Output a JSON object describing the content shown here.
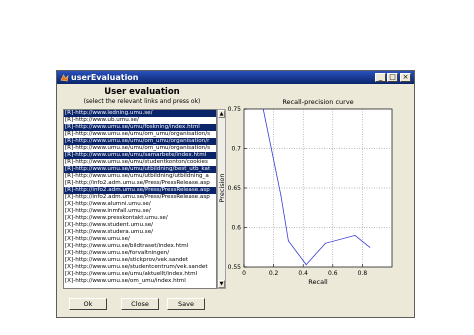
{
  "window": {
    "title": "userEvaluation",
    "buttons": {
      "minimize": "_",
      "maximize": "□",
      "close": "×"
    }
  },
  "panel": {
    "title": "User evaluation",
    "instructions": "(select the relevant links and press ok)"
  },
  "list": {
    "items": [
      {
        "label": "[R]-http://www.ledning.umu.se/",
        "selected": true
      },
      {
        "label": "[R]-http://www.ub.umu.se/",
        "selected": false
      },
      {
        "label": "[R]-http://www.umu.se/umu/foskning/index.html",
        "selected": true
      },
      {
        "label": "[R]-http://www.umu.se/umu/om_umu/organisation/s",
        "selected": false
      },
      {
        "label": "[R]-http://www.umu.se/umu/om_umu/organisation/r",
        "selected": true
      },
      {
        "label": "[R]-http://www.umu.se/umu/om_umu/organisation/s",
        "selected": false
      },
      {
        "label": "[R]-http://www.umu.se/umu/samarbete/index.html",
        "selected": true
      },
      {
        "label": "[R]-http://www.umu.se/umu/studentkonton/cookies",
        "selected": false
      },
      {
        "label": "[R]-http://www.umu.se/umu/utbildning/best_utb_kat",
        "selected": true
      },
      {
        "label": "[R]-http://www.umu.se/umu/utbildning/utbildning_a",
        "selected": false
      },
      {
        "label": "[R]-http://info2.adm.umu.se/Press/PressRelease.asp",
        "selected": false
      },
      {
        "label": "[R]-http://info2.adm.umu.se/Press/PressRelease.asp",
        "selected": true
      },
      {
        "label": "[X]-http://info2.adm.umu.se/Press/PressRelease.asp",
        "selected": false
      },
      {
        "label": "[X]-http://www.alumni.umu.se/",
        "selected": false
      },
      {
        "label": "[X]-http://www.inmfall.umu.se/",
        "selected": false
      },
      {
        "label": "[X]-http://www.presskontakt.umu.se/",
        "selected": false
      },
      {
        "label": "[X]-http://www.student.umu.se/",
        "selected": false
      },
      {
        "label": "[X]-http://www.studera.umu.se/",
        "selected": false
      },
      {
        "label": "[X]-http://www.umu.se/",
        "selected": false
      },
      {
        "label": "[X]-http://www.umu.se/bildtraset/index.html",
        "selected": false
      },
      {
        "label": "[X]-http://www.umu.se/forvaltningen/",
        "selected": false
      },
      {
        "label": "[X]-http://www.umu.se/stickprov/vek.sandet",
        "selected": false
      },
      {
        "label": "[X]-http://www.umu.se/studentcentrum/vek.sandet",
        "selected": false
      },
      {
        "label": "[X]-http://www.umu.se/umu/aktuellt/index.html",
        "selected": false
      },
      {
        "label": "[X]-http://www.umu.se/om_umu/index.html",
        "selected": false
      }
    ]
  },
  "buttons": {
    "ok": "Ok",
    "close": "Close",
    "save": "Save"
  },
  "colors": {
    "selection": "#0a246a",
    "line": "#3a3ad8"
  },
  "chart_data": {
    "type": "line",
    "title": "Recall-precision curve",
    "xlabel": "Recall",
    "ylabel": "Precision",
    "xlim": [
      0,
      1
    ],
    "ylim": [
      0.55,
      0.75
    ],
    "xticks": [
      "0",
      "0.2",
      "0.4",
      "0.6",
      "0.8"
    ],
    "xtick_values": [
      0,
      0.2,
      0.4,
      0.6,
      0.8
    ],
    "yticks": [
      "0.55",
      "0.6",
      "0.65",
      "0.7",
      "0.75"
    ],
    "ytick_values": [
      0.55,
      0.6,
      0.65,
      0.7,
      0.75
    ],
    "grid": true,
    "x": [
      0.13,
      0.25,
      0.3,
      0.42,
      0.55,
      0.75,
      0.85
    ],
    "y": [
      0.75,
      0.64,
      0.583,
      0.553,
      0.58,
      0.59,
      0.575
    ]
  }
}
